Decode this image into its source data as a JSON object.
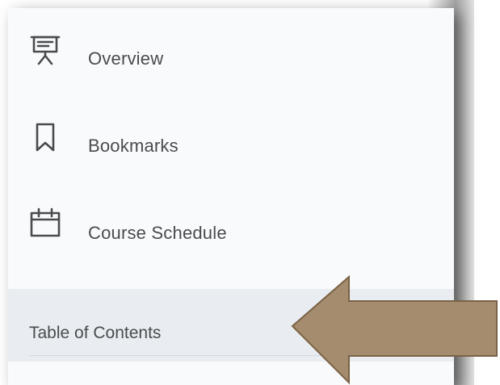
{
  "sidebar": {
    "items": [
      {
        "label": "Overview",
        "icon": "presentation-icon"
      },
      {
        "label": "Bookmarks",
        "icon": "bookmark-icon"
      },
      {
        "label": "Course Schedule",
        "icon": "calendar-icon"
      }
    ],
    "section": {
      "label": "Table of Contents"
    }
  },
  "colors": {
    "sidebar_bg": "#f9fafb",
    "section_bg": "#e9ecf0",
    "text": "#494c4e",
    "arrow_fill": "#a58c6e",
    "arrow_stroke": "#7a6246"
  }
}
